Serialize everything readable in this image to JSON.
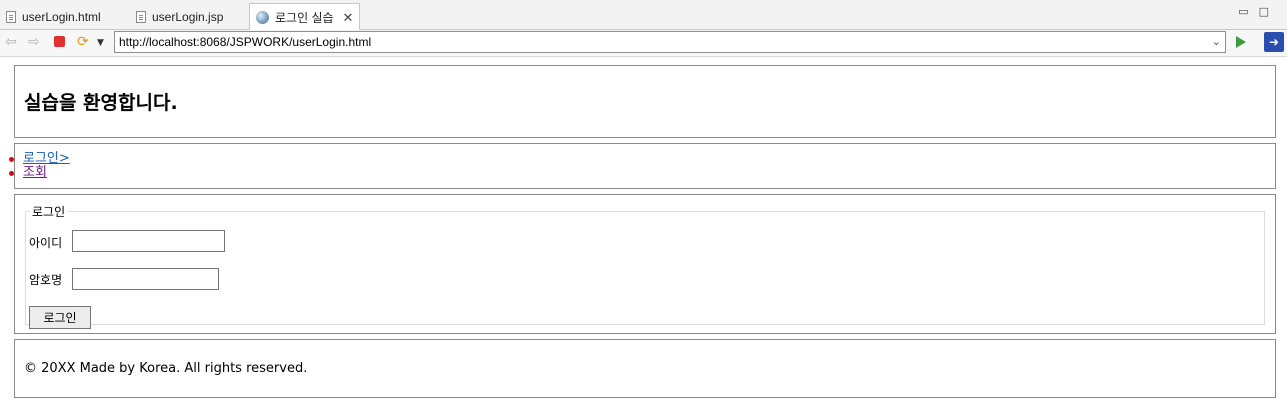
{
  "browser": {
    "tabs": [
      {
        "label": "userLogin.html",
        "icon": "file-icon"
      },
      {
        "label": "userLogin.jsp",
        "icon": "file-icon"
      },
      {
        "label": "로그인 실습",
        "icon": "globe-icon",
        "active": true
      }
    ],
    "address_bar": {
      "url": "http://localhost:8068/JSPWORK/userLogin.html"
    }
  },
  "page": {
    "header": {
      "title": "실습을 환영합니다."
    },
    "nav": {
      "items": [
        {
          "label": "로그인>"
        },
        {
          "label": "조회"
        }
      ]
    },
    "login_form": {
      "legend": "로그인",
      "id_label": "아이디",
      "id_value": "",
      "password_label": "암호명",
      "password_value": "",
      "submit_label": "로그인"
    },
    "footer": {
      "text": "© 20XX Made by Korea. All rights reserved."
    }
  },
  "colors": {
    "link": "#1a5fb4",
    "visited_link": "#6a1b8a",
    "bullet": "#d01010",
    "stop_button": "#e03030",
    "go_button": "#3d9a3d"
  }
}
